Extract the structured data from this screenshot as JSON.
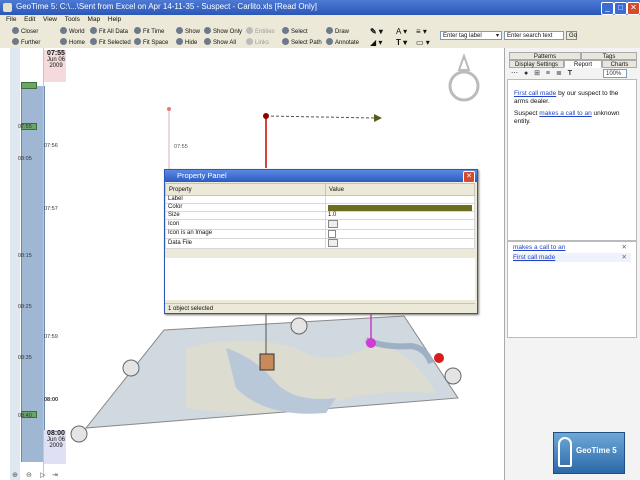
{
  "window": {
    "title": "GeoTime 5: C:\\...\\Sent from Excel on Apr 14-11-35 - Suspect - Carlito.xls [Read Only]",
    "buttons": [
      "_",
      "□",
      "✕"
    ]
  },
  "menu": [
    "File",
    "Edit",
    "View",
    "Tools",
    "Map",
    "Help"
  ],
  "toolbar": {
    "row1": [
      "Closer",
      "World",
      "Fit All Data",
      "Fit Time",
      "Show",
      "Show Only",
      "Entities",
      "Select",
      "Draw"
    ],
    "row2": [
      "Further",
      "Home",
      "Fit Selected",
      "Fit Space",
      "Hide",
      "Show All",
      "Links",
      "Select Path",
      "Annotate"
    ],
    "tag_label": "Enter tag label",
    "search_placeholder": "Enter search text",
    "go": "Go"
  },
  "timeline": {
    "top_time": "07:55",
    "top_date": "Jun 06",
    "top_year": "2009",
    "ticks": [
      "07:55",
      "08:05",
      "07:56",
      "07:57",
      "08:15",
      "08:25",
      "07:59",
      "08:35",
      "08:40",
      "08:00"
    ],
    "bottom_time": "08:00",
    "bottom_date": "Jun 06",
    "bottom_year": "2009"
  },
  "scene_label": "07:55",
  "panel": {
    "title": "Property Panel",
    "headers": [
      "Property",
      "Value"
    ],
    "rows": [
      {
        "property": "Label",
        "value": ""
      },
      {
        "property": "Color",
        "value": ""
      },
      {
        "property": "Size",
        "value": "1.0"
      },
      {
        "property": "Icon",
        "value": ""
      },
      {
        "property": "Icon is an Image",
        "value": ""
      },
      {
        "property": "Data File",
        "value": ""
      }
    ],
    "status": "1 object selected",
    "color_value": "#6b6d1e"
  },
  "right": {
    "tabs_row1": [
      "Patterns",
      "Tags"
    ],
    "tabs_row2": [
      "Display Settings",
      "Report",
      "Charts"
    ],
    "zoom": "100%",
    "report_link1": "First call made",
    "report_text1": " by our suspect to the arms dealer.",
    "report_text2a": "Suspect ",
    "report_link2": "makes a call to an",
    "report_text2b": " unknown entity.",
    "list": [
      "makes a call to an",
      "First call made"
    ]
  },
  "logo": "GeoTime 5"
}
